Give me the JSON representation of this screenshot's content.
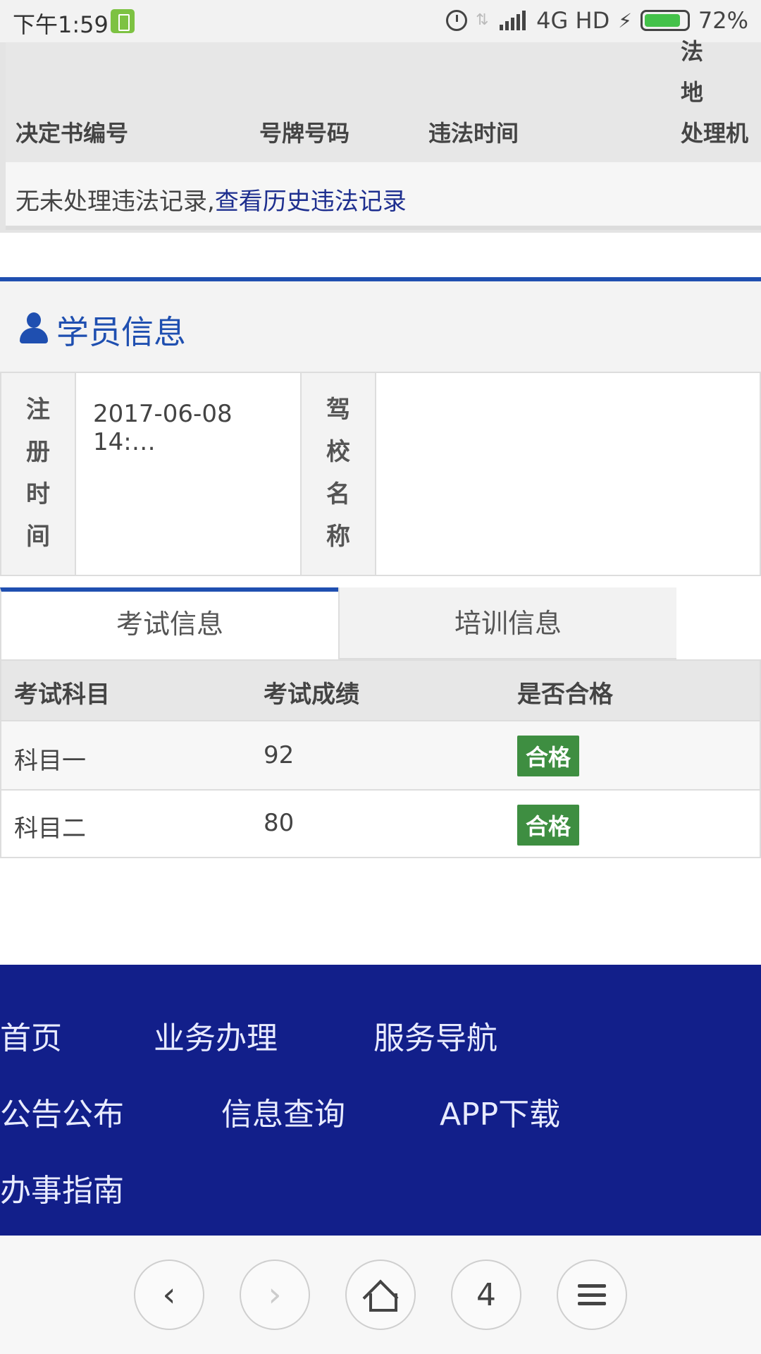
{
  "status_bar": {
    "time": "下午1:59",
    "network": "4G HD",
    "battery_percent": "72%",
    "battery_level": 0.72
  },
  "violation": {
    "headers": [
      "决定书编号",
      "号牌号码",
      "违法时间",
      "处理机"
    ],
    "header_extra_fragments": [
      "法",
      "地"
    ],
    "empty_text": "无未处理违法记录,",
    "history_link": "查看历史违法记录"
  },
  "student": {
    "title": "学员信息",
    "reg_time_label": "注册时间",
    "reg_time_value": "2017-06-08 14:…",
    "school_label": "驾校名称",
    "school_value": ""
  },
  "tabs": [
    {
      "label": "考试信息",
      "active": true
    },
    {
      "label": "培训信息",
      "active": false
    }
  ],
  "exam_table": {
    "headers": [
      "考试科目",
      "考试成绩",
      "是否合格"
    ],
    "rows": [
      {
        "subject": "科目一",
        "score": "92",
        "result": "合格"
      },
      {
        "subject": "科目二",
        "score": "80",
        "result": "合格"
      }
    ]
  },
  "footer": {
    "links": [
      "首页",
      "业务办理",
      "服务导航",
      "公告公布",
      "信息查询",
      "APP下载",
      "办事指南"
    ]
  },
  "browser_bar": {
    "tab_count": "4"
  },
  "colors": {
    "accent_blue": "#1f4fb0",
    "footer_bg": "#121f8a",
    "pass_green": "#3e8e41",
    "link_blue": "#1e2f8f"
  },
  "icons": [
    "alarm-icon",
    "data-transfer-icon",
    "signal-icon",
    "charging-bolt-icon",
    "battery-icon",
    "user-icon",
    "back-icon",
    "forward-icon",
    "home-icon",
    "menu-icon"
  ]
}
